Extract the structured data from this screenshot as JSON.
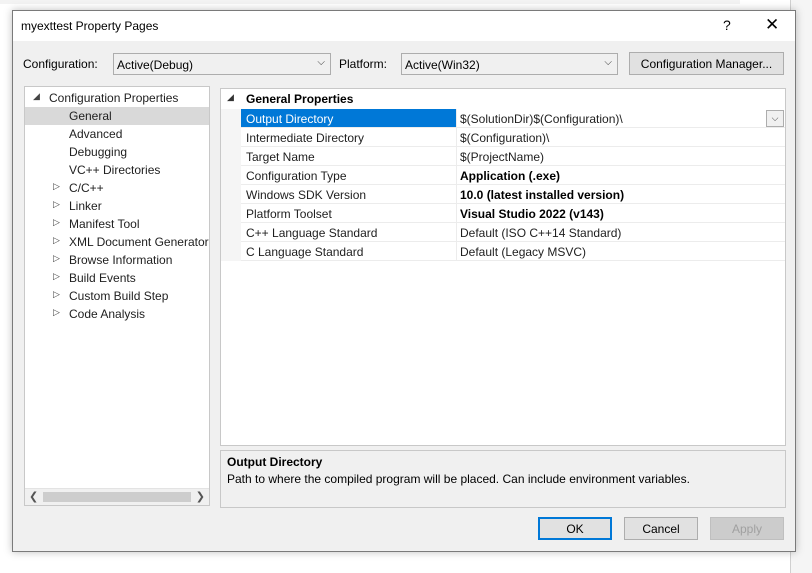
{
  "dialog": {
    "title": "myexttest Property Pages",
    "help_glyph": "?",
    "close_glyph": "✕"
  },
  "config": {
    "configuration_label": "Configuration:",
    "configuration_value": "Active(Debug)",
    "platform_label": "Platform:",
    "platform_value": "Active(Win32)",
    "manager_button": "Configuration Manager..."
  },
  "tree": {
    "root": "Configuration Properties",
    "items": [
      {
        "label": "General",
        "expandable": false,
        "selected": true
      },
      {
        "label": "Advanced",
        "expandable": false
      },
      {
        "label": "Debugging",
        "expandable": false
      },
      {
        "label": "VC++ Directories",
        "expandable": false
      },
      {
        "label": "C/C++",
        "expandable": true
      },
      {
        "label": "Linker",
        "expandable": true
      },
      {
        "label": "Manifest Tool",
        "expandable": true
      },
      {
        "label": "XML Document Generator",
        "expandable": true
      },
      {
        "label": "Browse Information",
        "expandable": true
      },
      {
        "label": "Build Events",
        "expandable": true
      },
      {
        "label": "Custom Build Step",
        "expandable": true
      },
      {
        "label": "Code Analysis",
        "expandable": true
      }
    ]
  },
  "grid": {
    "section": "General Properties",
    "rows": [
      {
        "name": "Output Directory",
        "value": "$(SolutionDir)$(Configuration)\\",
        "selected": true
      },
      {
        "name": "Intermediate Directory",
        "value": "$(Configuration)\\"
      },
      {
        "name": "Target Name",
        "value": "$(ProjectName)"
      },
      {
        "name": "Configuration Type",
        "value": "Application (.exe)",
        "bold": true
      },
      {
        "name": "Windows SDK Version",
        "value": "10.0 (latest installed version)",
        "bold": true
      },
      {
        "name": "Platform Toolset",
        "value": "Visual Studio 2022 (v143)",
        "bold": true
      },
      {
        "name": "C++ Language Standard",
        "value": "Default (ISO C++14 Standard)"
      },
      {
        "name": "C Language Standard",
        "value": "Default (Legacy MSVC)"
      }
    ]
  },
  "description": {
    "title": "Output Directory",
    "text": "Path to where the compiled program will be placed. Can include environment variables."
  },
  "buttons": {
    "ok": "OK",
    "cancel": "Cancel",
    "apply": "Apply"
  },
  "colors": {
    "selection": "#0078d7",
    "default_button_border": "#0078d7",
    "disabled_text": "#a0a0a0"
  }
}
